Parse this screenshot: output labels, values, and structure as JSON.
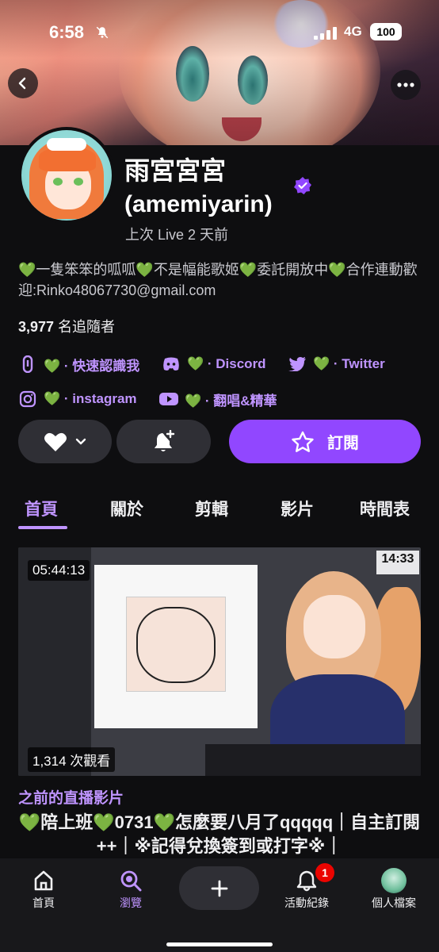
{
  "status_bar": {
    "time": "6:58",
    "network": "4G",
    "battery": "100"
  },
  "profile": {
    "display_name": "雨宮宮宮",
    "login_name": "(amemiyarin)",
    "last_live": "上次 Live 2 天前",
    "bio": "💚一隻笨笨的呱呱💚不是幅能歌姬💚委託開放中💚合作連動歡迎:Rinko48067730@gmail.com",
    "followers_count": "3,977",
    "followers_label": "名追隨者"
  },
  "links": [
    {
      "icon": "link-icon",
      "label": "💚 · 快速認識我"
    },
    {
      "icon": "discord-icon",
      "label": "💚 · Discord"
    },
    {
      "icon": "twitter-icon",
      "label": "💚 · Twitter"
    },
    {
      "icon": "instagram-icon",
      "label": "💚 · instagram"
    },
    {
      "icon": "youtube-icon",
      "label": "💚 · 翻唱&精華"
    }
  ],
  "actions": {
    "subscribe_label": "訂閱"
  },
  "tabs": [
    {
      "label": "首頁",
      "active": true
    },
    {
      "label": "關於",
      "active": false
    },
    {
      "label": "剪輯",
      "active": false
    },
    {
      "label": "影片",
      "active": false
    },
    {
      "label": "時間表",
      "active": false
    }
  ],
  "video": {
    "duration": "05:44:13",
    "views": "1,314 次觀看",
    "clock_overlay": "14:33",
    "section_label": "之前的直播影片",
    "title": "💚陪上班💚0731💚怎麼要八月了qqqqq｜自主訂閱++｜※記得兌換簽到或打字※｜"
  },
  "bottom_nav": [
    {
      "label": "首頁",
      "icon": "home-icon",
      "active": false
    },
    {
      "label": "瀏覽",
      "icon": "browse-icon",
      "active": true
    },
    {
      "label": "",
      "icon": "plus-icon",
      "active": false
    },
    {
      "label": "活動紀錄",
      "icon": "bell-icon",
      "active": false,
      "badge": "1"
    },
    {
      "label": "個人檔案",
      "icon": "profile-avatar",
      "active": false
    }
  ],
  "colors": {
    "accent": "#9147ff",
    "accent_text": "#bf94ff",
    "background": "#0e0e10"
  }
}
